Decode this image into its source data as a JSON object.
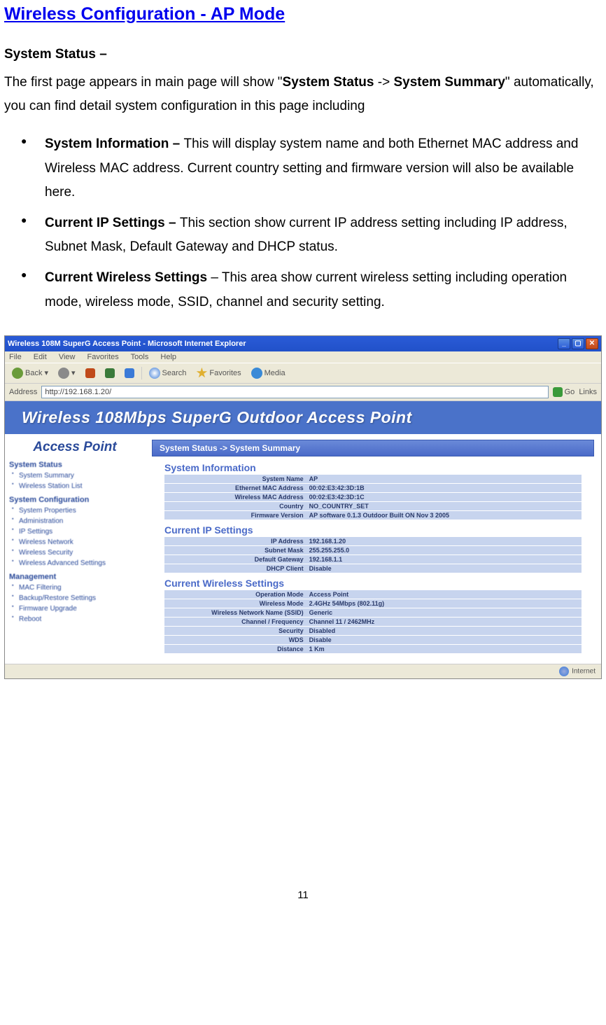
{
  "doc": {
    "title": "Wireless Configuration - AP Mode",
    "heading": "System Status –",
    "para_prefix": "The first page appears in main page will show \"",
    "para_bold1": "System Status",
    "para_arrow": " -> ",
    "para_bold2": "System Summary",
    "para_suffix": "\" automatically, you can find detail system configuration in this page including",
    "bullets": [
      {
        "b": "System Information – ",
        "t": "This will display system name and both Ethernet MAC address and Wireless MAC address. Current country setting and firmware version will also be available here."
      },
      {
        "b": "Current IP Settings – ",
        "t": "This section show current IP address setting including IP address, Subnet Mask, Default Gateway and DHCP status."
      },
      {
        "b": "Current Wireless Settings",
        "mid": " – ",
        "t": "This area show current wireless setting including operation mode, wireless mode, SSID, channel and security setting."
      }
    ],
    "pagenum": "11"
  },
  "win": {
    "title": "Wireless 108M SuperG Access Point - Microsoft Internet Explorer",
    "menu": [
      "File",
      "Edit",
      "View",
      "Favorites",
      "Tools",
      "Help"
    ],
    "toolbar": {
      "back": "Back",
      "search": "Search",
      "favorites": "Favorites",
      "media": "Media"
    },
    "addr_label": "Address",
    "url": "http://192.168.1.20/",
    "go": "Go",
    "links": "Links",
    "status_left": "",
    "status_right": "Internet"
  },
  "page": {
    "banner": "Wireless 108Mbps SuperG Outdoor Access Point",
    "ap_title": "Access Point",
    "crumb": "System Status -> System Summary",
    "sidebar": {
      "s1": "System Status",
      "s1_items": [
        "System Summary",
        "Wireless Station List"
      ],
      "s2": "System Configuration",
      "s2_items": [
        "System Properties",
        "Administration",
        "IP Settings",
        "Wireless Network",
        "Wireless Security",
        "Wireless Advanced Settings"
      ],
      "s3": "Management",
      "s3_items": [
        "MAC Filtering",
        "Backup/Restore Settings",
        "Firmware Upgrade",
        "Reboot"
      ]
    },
    "sections": {
      "sys": "System Information",
      "ip": "Current IP Settings",
      "wl": "Current Wireless Settings"
    },
    "sys_rows": [
      {
        "l": "System Name",
        "v": "AP"
      },
      {
        "l": "Ethernet MAC Address",
        "v": "00:02:E3:42:3D:1B"
      },
      {
        "l": "Wireless MAC Address",
        "v": "00:02:E3:42:3D:1C"
      },
      {
        "l": "Country",
        "v": "NO_COUNTRY_SET"
      },
      {
        "l": "Firmware Version",
        "v": "AP software 0.1.3 Outdoor Built ON Nov 3 2005"
      }
    ],
    "ip_rows": [
      {
        "l": "IP Address",
        "v": "192.168.1.20"
      },
      {
        "l": "Subnet Mask",
        "v": "255.255.255.0"
      },
      {
        "l": "Default Gateway",
        "v": "192.168.1.1"
      },
      {
        "l": "DHCP Client",
        "v": "Disable"
      }
    ],
    "wl_rows": [
      {
        "l": "Operation Mode",
        "v": "Access Point"
      },
      {
        "l": "Wireless Mode",
        "v": "2.4GHz 54Mbps (802.11g)"
      },
      {
        "l": "Wireless Network Name (SSID)",
        "v": "Generic"
      },
      {
        "l": "Channel / Frequency",
        "v": "Channel 11 / 2462MHz"
      },
      {
        "l": "Security",
        "v": "Disabled"
      },
      {
        "l": "WDS",
        "v": "Disable"
      },
      {
        "l": "Distance",
        "v": "1 Km"
      }
    ]
  }
}
